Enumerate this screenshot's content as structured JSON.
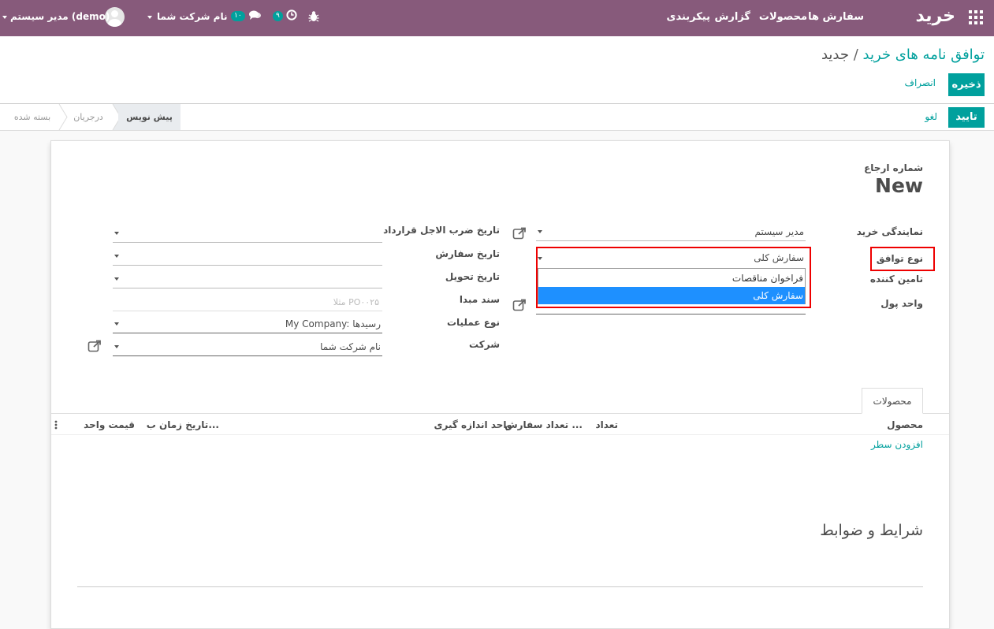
{
  "topbar": {
    "app_name": "خرید",
    "menu": [
      "سفارش ها",
      "محصولات",
      "گزارش",
      "پیکربندی"
    ],
    "user_name": "مدیر سیستم (demo)",
    "company": "نام شرکت شما",
    "activity_count": "۹",
    "message_count": "۱۰"
  },
  "breadcrumb": {
    "parent": "توافق نامه های خرید",
    "separator": "/",
    "current": "جدید"
  },
  "buttons": {
    "save": "ذخیره",
    "discard": "انصراف",
    "confirm": "تایید",
    "cancel": "لغو"
  },
  "statusbar": {
    "stages": [
      "پیش نویس",
      "درجریان",
      "بسته شده"
    ],
    "active": "پیش نویس"
  },
  "form": {
    "ref_label": "شماره ارجاع",
    "ref_value": "New",
    "right": {
      "rep_label": "نمایندگی خرید",
      "rep_value": "مدیر سیستم",
      "type_label": "نوع توافق",
      "type_value": "سفارش کلی",
      "vendor_label": "تامین کننده",
      "currency_label": "واحد پول"
    },
    "left": {
      "deadline_label": "تاریخ ضرب الاجل قرارداد",
      "order_date_label": "تاریخ سفارش",
      "delivery_date_label": "تاریخ تحویل",
      "source_label": "سند مبدا",
      "source_placeholder": "مثلا PO۰۰۲۵",
      "operation_label": "نوع عملیات",
      "operation_value": "My Company: رسیدها",
      "company_label": "شرکت",
      "company_value": "نام شرکت شما"
    },
    "dropdown": {
      "options": [
        "فراخوان مناقصات",
        "سفارش کلی"
      ],
      "selected": "سفارش کلی"
    }
  },
  "tabs": {
    "products": "محصولات"
  },
  "table": {
    "columns": [
      "محصول",
      "تعداد",
      "تعداد سفارش ...",
      "واحد اندازه گیری",
      "تاریخ زمان ب...",
      "قیمت واحد"
    ],
    "add_line": "افزودن سطر"
  },
  "terms": "شرایط و ضوابط"
}
